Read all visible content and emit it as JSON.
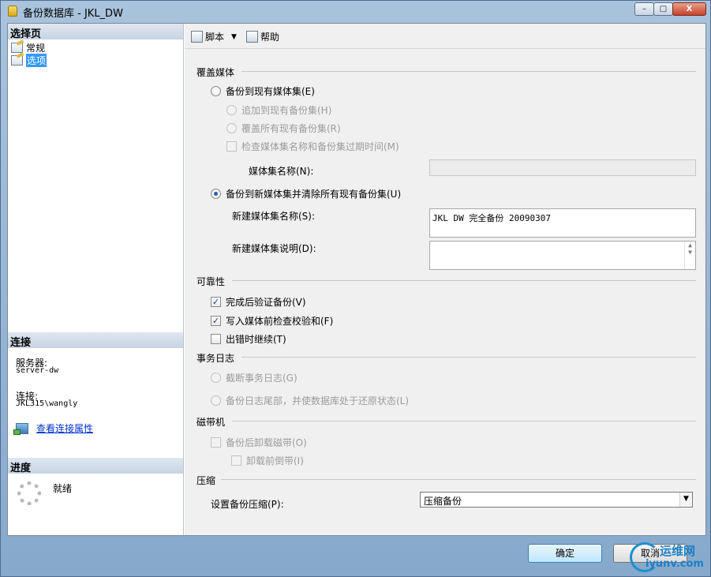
{
  "window": {
    "title": "备份数据库 - JKL_DW",
    "buttons": {
      "minimize": "–",
      "maximize": "□",
      "close": "X"
    }
  },
  "left_panel": {
    "select_page_header": "选择页",
    "pages": [
      {
        "label": "常规",
        "selected": false
      },
      {
        "label": "选项",
        "selected": true
      }
    ],
    "connection_header": "连接",
    "server_label": "服务器:",
    "server_value": "server-dw",
    "connection_label": "连接:",
    "connection_value": "JKL315\\wangly",
    "view_connection_link": "查看连接属性",
    "progress_header": "进度",
    "progress_status": "就绪"
  },
  "toolbar": {
    "script_label": "脚本",
    "help_label": "帮助"
  },
  "overwrite_media": {
    "title": "覆盖媒体",
    "backup_existing_set": "备份到现有媒体集(E)",
    "append_existing": "追加到现有备份集(H)",
    "overwrite_all": "覆盖所有现有备份集(R)",
    "check_media_name": "检查媒体集名称和备份集过期时间(M)",
    "media_set_name_label": "媒体集名称(N):",
    "media_set_name_value": "",
    "backup_new_set": "备份到新媒体集并清除所有现有备份集(U)",
    "new_media_name_label": "新建媒体集名称(S):",
    "new_media_name_value": "JKL DW 完全备份 20090307",
    "new_media_desc_label": "新建媒体集说明(D):",
    "new_media_desc_value": ""
  },
  "reliability": {
    "title": "可靠性",
    "verify_backup": "完成后验证备份(V)",
    "verify_checked": true,
    "checksum": "写入媒体前检查校验和(F)",
    "checksum_checked": true,
    "continue_on_error": "出错时继续(T)",
    "continue_checked": false
  },
  "transaction_log": {
    "title": "事务日志",
    "truncate": "截断事务日志(G)",
    "tail_log": "备份日志尾部，并使数据库处于还原状态(L)"
  },
  "tape_drive": {
    "title": "磁带机",
    "unload_tape": "备份后卸载磁带(O)",
    "rewind_tape": "卸载前倒带(I)"
  },
  "compression": {
    "title": "压缩",
    "setting_label": "设置备份压缩(P):",
    "setting_value": "压缩备份"
  },
  "footer": {
    "ok_label": "确定",
    "cancel_label": "取消"
  },
  "watermark": {
    "cn": "运维网",
    "en": "iyunv.com"
  }
}
